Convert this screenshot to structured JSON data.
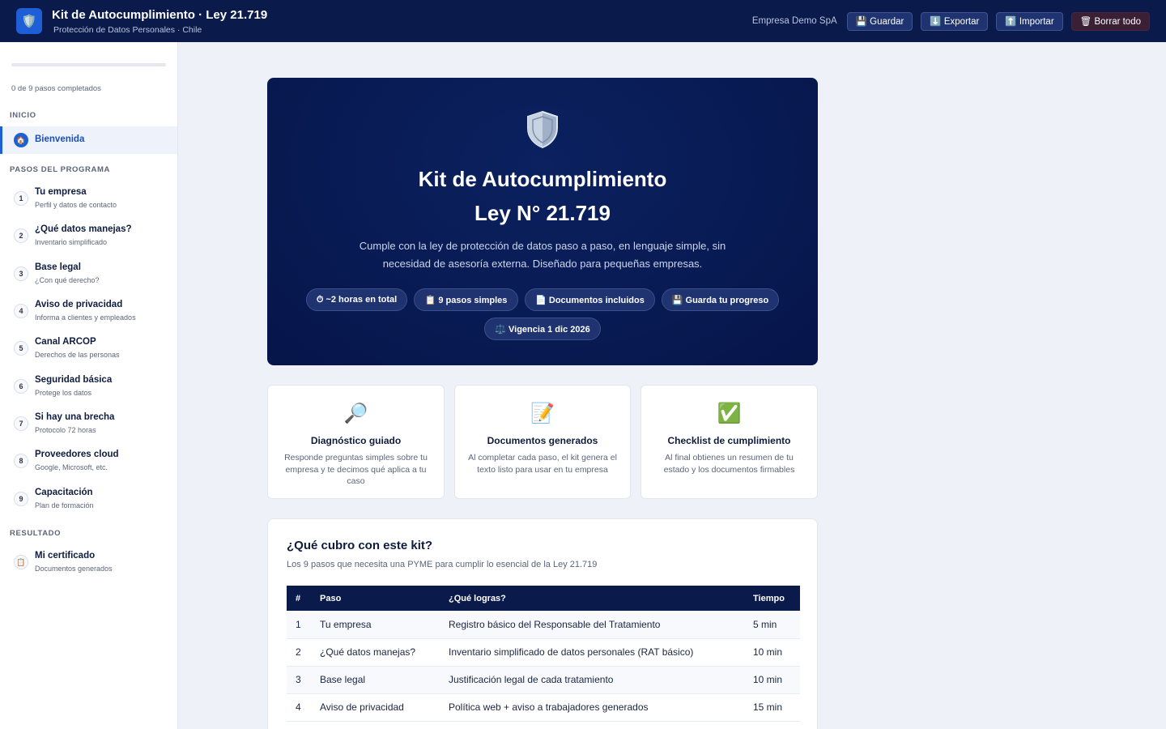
{
  "header": {
    "title": "Kit de Autocumplimiento · Ley 21.719",
    "subtitle": "Protección de Datos Personales · Chile",
    "company": "Empresa Demo SpA",
    "buttons": {
      "save": "💾 Guardar",
      "export": "⬇️ Exportar",
      "import": "⬆️ Importar",
      "clear": "🗑 Borrar todo"
    }
  },
  "sidebar": {
    "progress_text": "0 de 9 pasos completados",
    "progress_fraction": 0,
    "sections": {
      "start": "INICIO",
      "steps": "PASOS DEL PROGRAMA",
      "result": "RESULTADO"
    },
    "welcome": {
      "icon": "🏠",
      "label": "Bienvenida"
    },
    "steps": [
      {
        "num": "1",
        "title": "Tu empresa",
        "sub": "Perfil y datos de contacto"
      },
      {
        "num": "2",
        "title": "¿Qué datos manejas?",
        "sub": "Inventario simplificado"
      },
      {
        "num": "3",
        "title": "Base legal",
        "sub": "¿Con qué derecho?"
      },
      {
        "num": "4",
        "title": "Aviso de privacidad",
        "sub": "Informa a clientes y empleados"
      },
      {
        "num": "5",
        "title": "Canal ARCOP",
        "sub": "Derechos de las personas"
      },
      {
        "num": "6",
        "title": "Seguridad básica",
        "sub": "Protege los datos"
      },
      {
        "num": "7",
        "title": "Si hay una brecha",
        "sub": "Protocolo 72 horas"
      },
      {
        "num": "8",
        "title": "Proveedores cloud",
        "sub": "Google, Microsoft, etc."
      },
      {
        "num": "9",
        "title": "Capacitación",
        "sub": "Plan de formación"
      }
    ],
    "certificate": {
      "icon": "📋",
      "title": "Mi certificado",
      "sub": "Documentos generados"
    }
  },
  "hero": {
    "title_line1": "Kit de Autocumplimiento",
    "title_line2": "Ley N° 21.719",
    "description": "Cumple con la ley de protección de datos paso a paso, en lenguaje simple, sin necesidad de asesoría externa. Diseñado para pequeñas empresas.",
    "pills": [
      "⏱ ~2 horas en total",
      "📋 9 pasos simples",
      "📄 Documentos incluidos",
      "💾 Guarda tu progreso",
      "⚖️ Vigencia 1 dic 2026"
    ]
  },
  "features": [
    {
      "icon": "🔎",
      "title": "Diagnóstico guiado",
      "text": "Responde preguntas simples sobre tu empresa y te decimos qué aplica a tu caso"
    },
    {
      "icon": "📝",
      "title": "Documentos generados",
      "text": "Al completar cada paso, el kit genera el texto listo para usar en tu empresa"
    },
    {
      "icon": "✅",
      "title": "Checklist de cumplimiento",
      "text": "Al final obtienes un resumen de tu estado y los documentos firmables"
    }
  ],
  "coverage": {
    "title": "¿Qué cubro con este kit?",
    "subtitle": "Los 9 pasos que necesita una PYME para cumplir lo esencial de la Ley 21.719",
    "columns": [
      "#",
      "Paso",
      "¿Qué logras?",
      "Tiempo"
    ],
    "rows": [
      [
        "1",
        "Tu empresa",
        "Registro básico del Responsable del Tratamiento",
        "5 min"
      ],
      [
        "2",
        "¿Qué datos manejas?",
        "Inventario simplificado de datos personales (RAT básico)",
        "10 min"
      ],
      [
        "3",
        "Base legal",
        "Justificación legal de cada tratamiento",
        "10 min"
      ],
      [
        "4",
        "Aviso de privacidad",
        "Política web + aviso a trabajadores generados",
        "15 min"
      ]
    ]
  }
}
